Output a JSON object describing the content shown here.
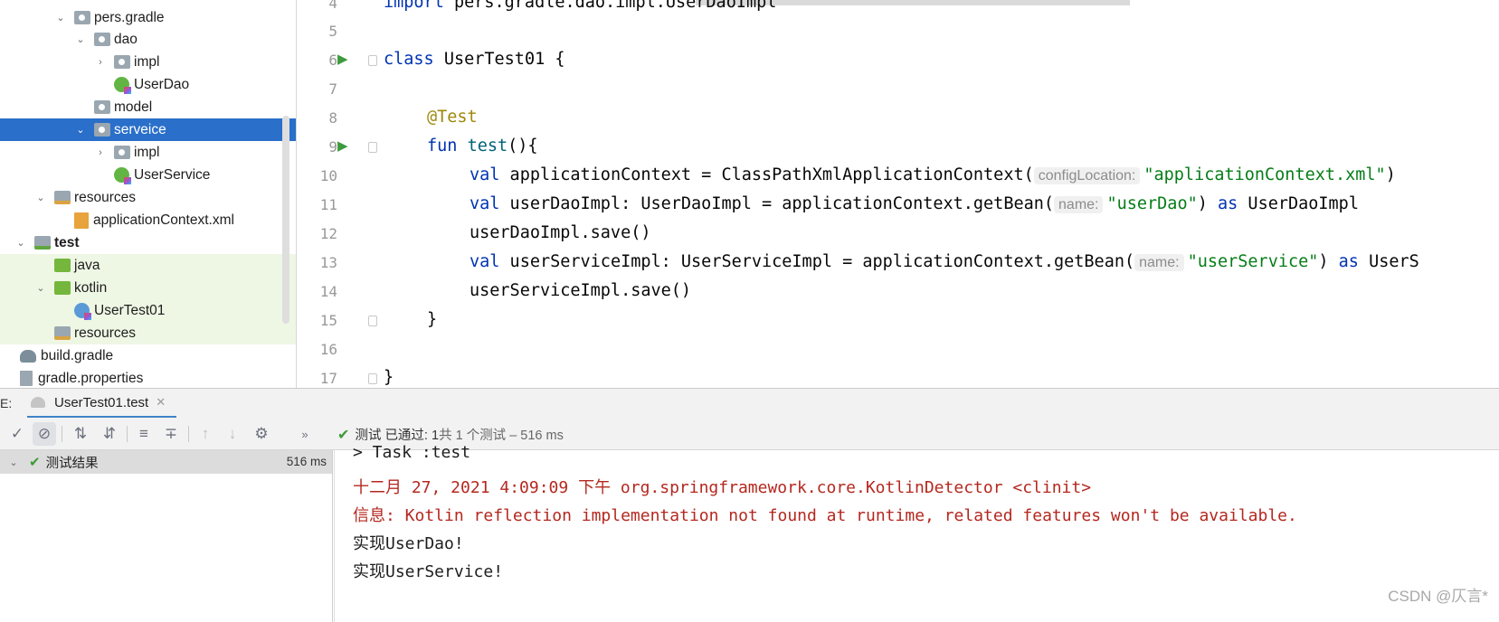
{
  "tree": {
    "items": [
      {
        "label": "pers.gradle",
        "icon": "package-icon"
      },
      {
        "label": "dao",
        "icon": "package-icon"
      },
      {
        "label": "impl",
        "icon": "package-icon"
      },
      {
        "label": "UserDao",
        "icon": "kotlin-interface-icon"
      },
      {
        "label": "model",
        "icon": "package-icon"
      },
      {
        "label": "serveice",
        "icon": "package-icon",
        "selected": true
      },
      {
        "label": "impl",
        "icon": "package-icon"
      },
      {
        "label": "UserService",
        "icon": "kotlin-interface-icon"
      },
      {
        "label": "resources",
        "icon": "resources-folder-icon"
      },
      {
        "label": "applicationContext.xml",
        "icon": "xml-file-icon"
      },
      {
        "label": "test",
        "icon": "test-folder-icon"
      },
      {
        "label": "java",
        "icon": "test-source-folder-icon"
      },
      {
        "label": "kotlin",
        "icon": "test-source-folder-icon"
      },
      {
        "label": "UserTest01",
        "icon": "kotlin-class-icon"
      },
      {
        "label": "resources",
        "icon": "resources-folder-icon"
      },
      {
        "label": "build.gradle",
        "icon": "gradle-icon"
      },
      {
        "label": "gradle.properties",
        "icon": "properties-icon"
      }
    ]
  },
  "editor": {
    "line_numbers": [
      "4",
      "5",
      "6",
      "7",
      "8",
      "9",
      "10",
      "11",
      "12",
      "13",
      "14",
      "15",
      "16",
      "17"
    ],
    "code": {
      "l4_kw": "import",
      "l4_rest": " pers.gradle.dao.impl.UserDaoImpl",
      "l6_kw": "class",
      "l6_rest": " UserTest01 {",
      "l8_ann": "@Test",
      "l9_kw": "fun",
      "l9_fn": "test",
      "l9_rest": "(){",
      "l10_kw": "val",
      "l10_a": " applicationContext = ClassPathXmlApplicationContext(",
      "l10_hint": "configLocation:",
      "l10_str": "\"applicationContext.xml\"",
      "l10_b": ")",
      "l11_kw": "val",
      "l11_a": " userDaoImpl: UserDaoImpl = applicationContext.getBean(",
      "l11_hint": "name:",
      "l11_str": "\"userDao\"",
      "l11_b": ") ",
      "l11_kw2": "as",
      "l11_c": " UserDaoImpl",
      "l12": "userDaoImpl.save()",
      "l13_kw": "val",
      "l13_a": " userServiceImpl: UserServiceImpl = applicationContext.getBean(",
      "l13_hint": "name:",
      "l13_str": "\"userService\"",
      "l13_b": ") ",
      "l13_kw2": "as",
      "l13_c": " UserS",
      "l14": "userServiceImpl.save()",
      "l15": "}",
      "l17": "}"
    }
  },
  "run_panel": {
    "label_prefix": "E:",
    "tab_label": "UserTest01.test",
    "status_prefix": "测试",
    "status_bold": "已通过: 1",
    "status_rest": "共 1 个测试 – 516 ms",
    "results_root": "测试结果",
    "results_time": "516 ms",
    "console": [
      {
        "text": "> Task :test",
        "color": "normal"
      },
      {
        "text": "十二月 27, 2021 4:09:09 下午 org.springframework.core.KotlinDetector <clinit>",
        "color": "red"
      },
      {
        "text": "信息: Kotlin reflection implementation not found at runtime, related features won't be available.",
        "color": "red"
      },
      {
        "text": "实现UserDao!",
        "color": "normal"
      },
      {
        "text": "实现UserService!",
        "color": "normal"
      }
    ]
  },
  "watermark": "CSDN @仄言*",
  "colors": {
    "selection": "#2a6fc9",
    "keyword": "#0033b3",
    "string": "#067d17",
    "annotation": "#9e880d",
    "error_red": "#b4281f",
    "pass_green": "#3d9b35"
  }
}
